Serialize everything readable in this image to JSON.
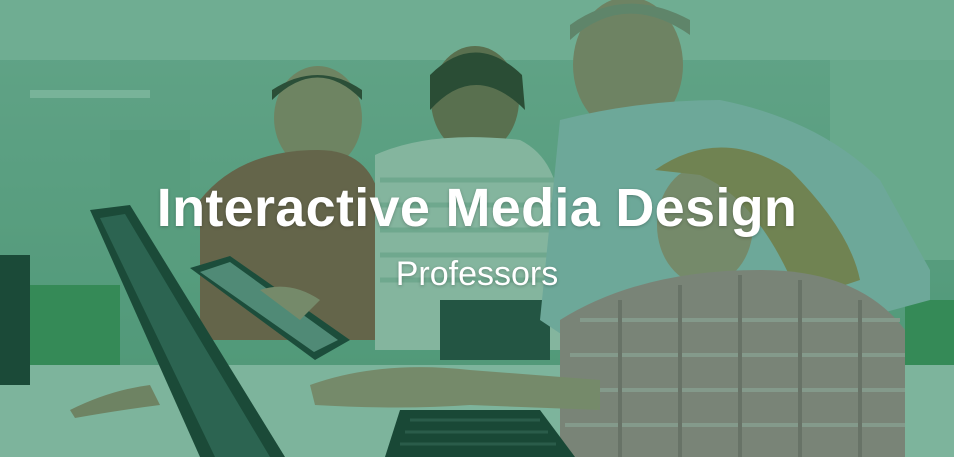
{
  "banner": {
    "title": "Interactive Media Design",
    "subtitle": "Professors"
  }
}
